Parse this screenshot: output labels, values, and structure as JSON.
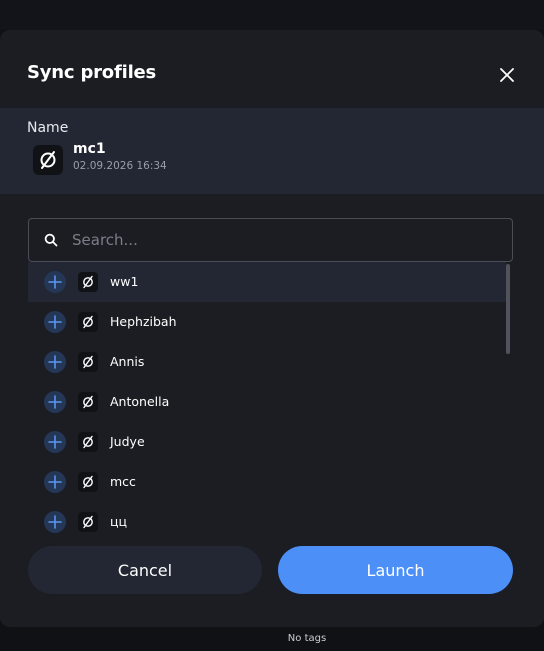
{
  "modal": {
    "title": "Sync profiles",
    "close_icon": "close-icon"
  },
  "selected": {
    "label": "Name",
    "name": "mc1",
    "date": "02.09.2026 16:34",
    "icon": "empty-set-icon"
  },
  "search": {
    "placeholder": "Search...",
    "value": ""
  },
  "profiles": [
    {
      "name": "ww1"
    },
    {
      "name": "Hephzibah"
    },
    {
      "name": "Annis"
    },
    {
      "name": "Antonella"
    },
    {
      "name": "Judye"
    },
    {
      "name": "mcc"
    },
    {
      "name": "цц"
    }
  ],
  "buttons": {
    "cancel": "Cancel",
    "launch": "Launch"
  },
  "footer": {
    "tags": "No tags"
  },
  "colors": {
    "accent": "#4b8ff7",
    "add_button_bg": "#243757",
    "modal_bg": "#1b1d22",
    "highlight_bg": "#222733"
  }
}
